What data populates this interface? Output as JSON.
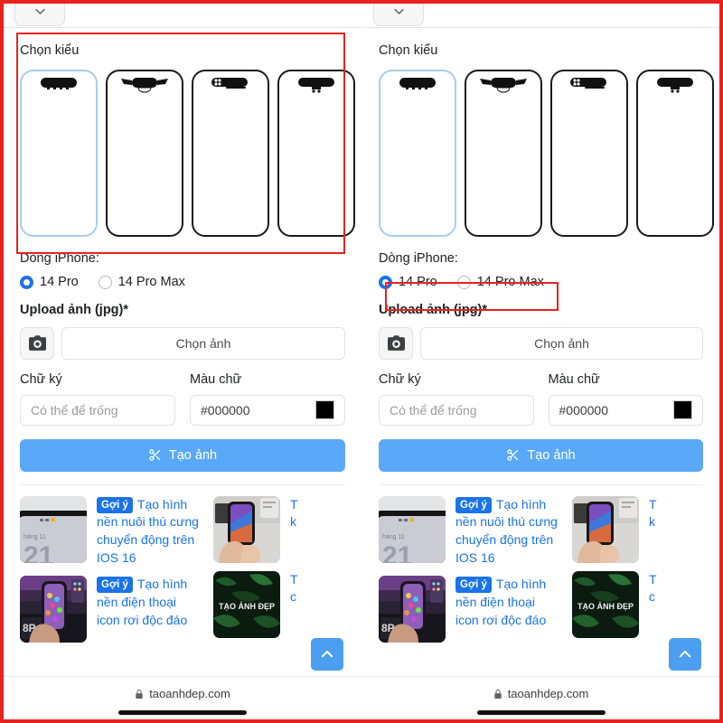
{
  "browser": {
    "tab_icon": "chevron-down-icon",
    "url": "taoanhdep.com",
    "lock_icon": "lock-icon"
  },
  "form": {
    "style_label": "Chọn kiểu",
    "styles": [
      {
        "name": "dynamic-island-plain",
        "selected": true
      },
      {
        "name": "dynamic-island-wings",
        "selected": false
      },
      {
        "name": "dynamic-island-pill-dots",
        "selected": false
      },
      {
        "name": "dynamic-island-cart",
        "selected": false
      }
    ],
    "model_label": "Dòng iPhone:",
    "model_options": [
      {
        "label": "14 Pro",
        "selected": true
      },
      {
        "label": "14 Pro Max",
        "selected": false
      }
    ],
    "upload_label": "Upload ảnh (jpg)*",
    "camera_icon": "camera-icon",
    "file_button_label": "Chọn ảnh",
    "signature_label": "Chữ ký",
    "signature_placeholder": "Có thể để trống",
    "signature_value": "",
    "color_label": "Màu chữ",
    "color_value": "#000000",
    "color_swatch": "#000000",
    "submit_label": "Tạo ảnh",
    "submit_icon": "scissors-icon",
    "submit_color": "#5aa9f8"
  },
  "suggestions": {
    "badge_label": "Gợi ý",
    "items": [
      {
        "title": "Tạo hình nền nuôi thú cưng chuyển động trên IOS 16",
        "thumb": "phone-corner-lockscreen-thumb"
      },
      {
        "title": "Tạo hình nền điện thoại icon rơi độc đáo",
        "thumb": "hand-holding-purple-phone-thumb"
      }
    ],
    "side_items": [
      {
        "title_clip": "T\nk",
        "thumb": "hand-holding-phone-gray-thumb"
      },
      {
        "title_clip": "T\nc",
        "thumb": "tao-anh-dep-leaves-thumb",
        "thumb_text": "TẠO ẢNH ĐẸP"
      }
    ]
  },
  "fab": {
    "icon": "chevron-up-icon",
    "color": "#4c9ef0"
  },
  "annotations": {
    "outline_color": "#e8221c",
    "left_target": "style-picker",
    "right_target": "iphone-model-radio-group"
  }
}
